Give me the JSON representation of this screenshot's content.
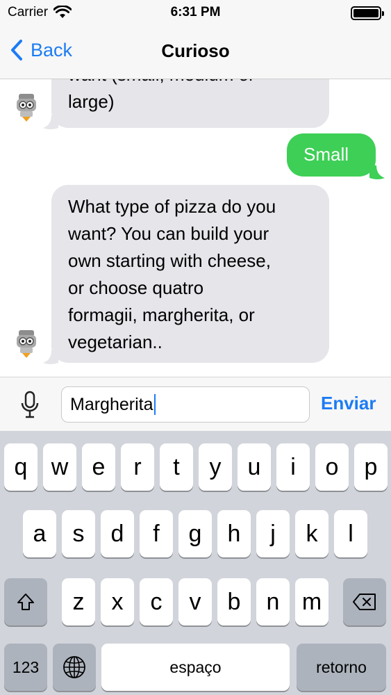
{
  "status_bar": {
    "carrier": "Carrier",
    "time": "6:31 PM",
    "battery_level": 1.0
  },
  "nav": {
    "back_label": "Back",
    "title": "Curioso"
  },
  "messages": [
    {
      "from": "bot",
      "lines": [
        "want (small, medium or",
        "large)"
      ]
    },
    {
      "from": "user",
      "lines": [
        "Small"
      ]
    },
    {
      "from": "bot",
      "lines": [
        "What type of pizza do you",
        "want? You can build your",
        "own starting with cheese,",
        "or choose quatro",
        "formagii, margherita, or",
        "vegetarian.."
      ]
    }
  ],
  "input": {
    "value": "Margherita",
    "send_label": "Enviar"
  },
  "keyboard": {
    "row1": [
      "q",
      "w",
      "e",
      "r",
      "t",
      "y",
      "u",
      "i",
      "o",
      "p"
    ],
    "row2": [
      "a",
      "s",
      "d",
      "f",
      "g",
      "h",
      "j",
      "k",
      "l"
    ],
    "row3": [
      "z",
      "x",
      "c",
      "v",
      "b",
      "n",
      "m"
    ],
    "numbers_label": "123",
    "space_label": "espaço",
    "return_label": "retorno"
  },
  "colors": {
    "accent": "#1c7cf4",
    "outgoing_bubble": "#3ecf56",
    "incoming_bubble": "#e5e5ea",
    "keyboard_bg": "#d1d4da"
  },
  "icons": [
    "wifi-icon",
    "battery-icon",
    "chevron-left-icon",
    "robot-avatar-icon",
    "microphone-icon",
    "shift-icon",
    "delete-icon",
    "globe-icon"
  ]
}
